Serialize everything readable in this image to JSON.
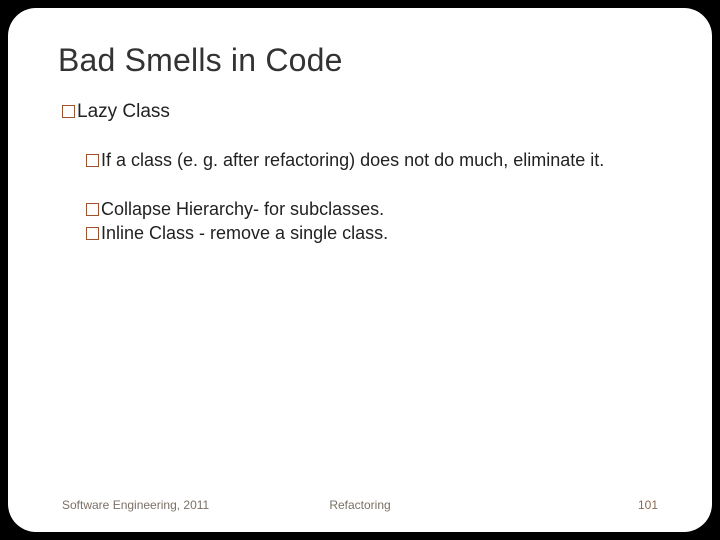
{
  "title": "Bad Smells in Code",
  "lvl1": "Lazy Class",
  "item1": "If a class (e. g. after refactoring) does not do much, eliminate it.",
  "item2": "Collapse Hierarchy- for subclasses.",
  "item3": "Inline Class - remove a single class.",
  "footer": {
    "left": "Software Engineering, 2011",
    "center": "Refactoring",
    "right": "101"
  }
}
